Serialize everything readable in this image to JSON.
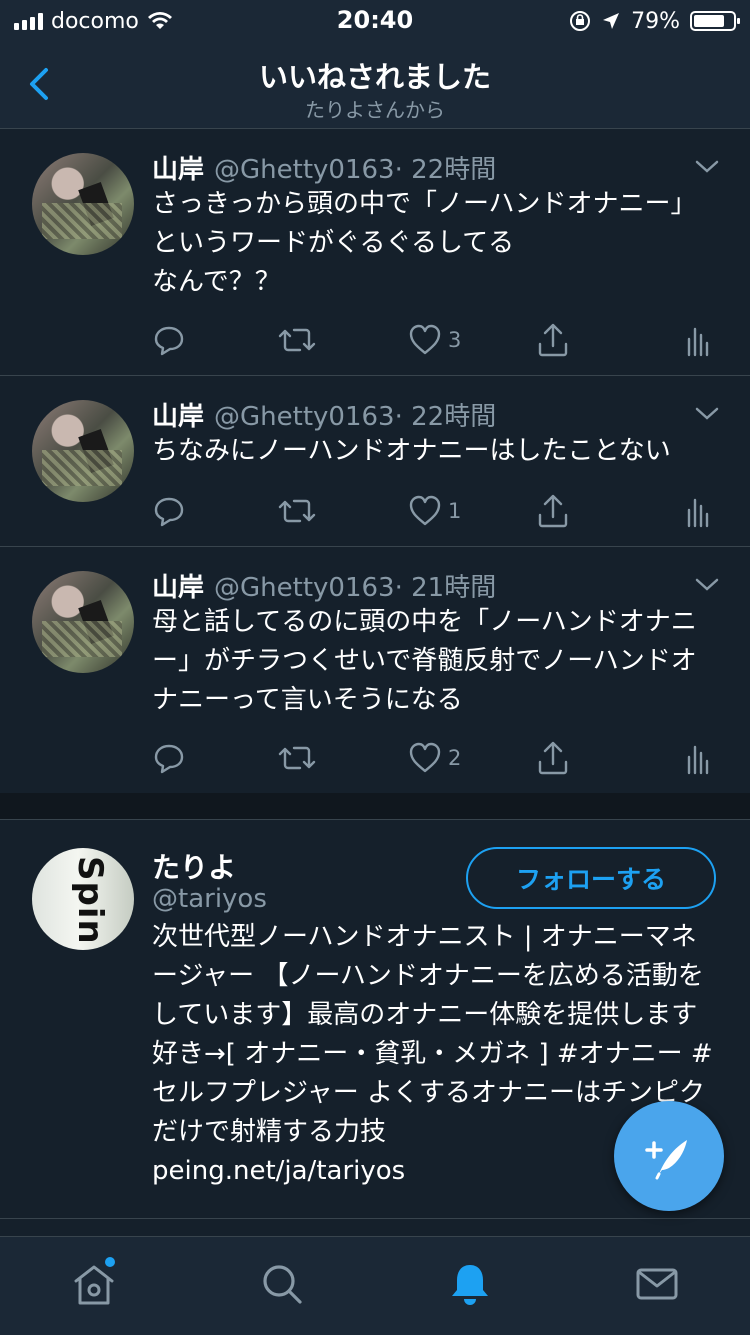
{
  "status": {
    "carrier": "docomo",
    "time": "20:40",
    "battery": "79%"
  },
  "nav": {
    "title": "いいねされました",
    "subtitle": "たりよさんから"
  },
  "tweets": [
    {
      "name": "山岸",
      "handle": "@Ghetty0163",
      "time": "· 22時間",
      "text": "さっきっから頭の中で「ノーハンドオナニー」というワードがぐるぐるしてる\nなんで？？",
      "likes": "3"
    },
    {
      "name": "山岸",
      "handle": "@Ghetty0163",
      "time": "· 22時間",
      "text": "ちなみにノーハンドオナニーはしたことない",
      "likes": "1"
    },
    {
      "name": "山岸",
      "handle": "@Ghetty0163",
      "time": "· 21時間",
      "text": "母と話してるのに頭の中を「ノーハンドオナニー」がチラつくせいで脊髄反射でノーハンドオナニーって言いそうになる",
      "likes": "2"
    }
  ],
  "profile": {
    "name": "たりよ",
    "handle": "@tariyos",
    "follow_label": "フォローする",
    "avatar_text": "Spin",
    "bio": "次世代型ノーハンドオナニスト | オナニーマネージャー 【ノーハンドオナニーを広める活動をしています】最高のオナニー体験を提供します 好き→[ オナニー・貧乳・メガネ ] #オナニー #セルフプレジャー よくするオナニーはチンピクだけで射精する力技\npeing.net/ja/tariyos"
  },
  "icons": {
    "back": "chevron-left-icon",
    "caret": "chevron-down-icon",
    "reply": "reply-icon",
    "retweet": "retweet-icon",
    "like": "heart-icon",
    "share": "share-icon",
    "analytics": "analytics-icon",
    "compose": "compose-tweet-icon",
    "home": "home-icon",
    "search": "search-icon",
    "notifications": "bell-icon",
    "messages": "mail-icon"
  },
  "colors": {
    "background": "#15202b",
    "accent": "#1da1f2",
    "secondary_text": "#8899a6"
  }
}
